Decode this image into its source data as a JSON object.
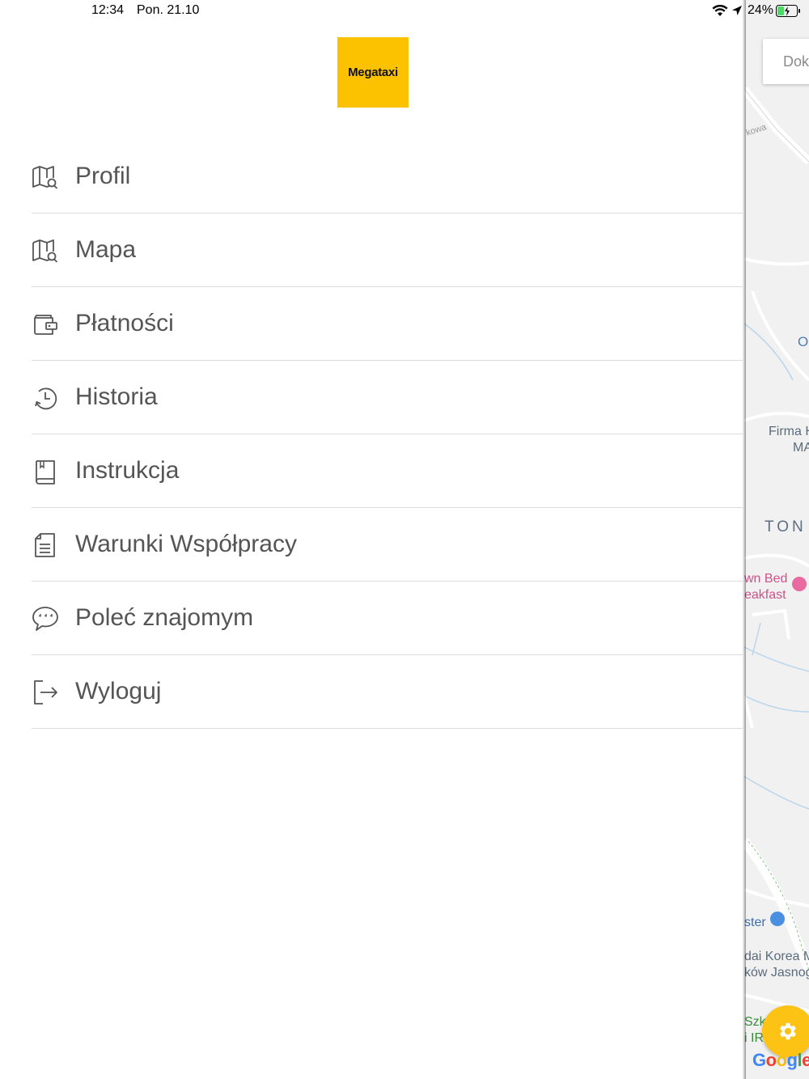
{
  "status_bar": {
    "time": "12:34",
    "date": "Pon. 21.10",
    "battery_percent": "24%"
  },
  "logo": {
    "text": "Megataxi",
    "bg_color": "#fcc200"
  },
  "menu": {
    "items": [
      {
        "label": "Profil",
        "icon": "map-search-icon"
      },
      {
        "label": "Mapa",
        "icon": "map-search-icon"
      },
      {
        "label": "Płatności",
        "icon": "wallet-icon"
      },
      {
        "label": "Historia",
        "icon": "history-icon"
      },
      {
        "label": "Instrukcja",
        "icon": "book-icon"
      },
      {
        "label": "Warunki Współpracy",
        "icon": "document-icon"
      },
      {
        "label": "Poleć znajomym",
        "icon": "chat-bubble-icon"
      },
      {
        "label": "Wyloguj",
        "icon": "logout-icon"
      }
    ]
  },
  "map": {
    "search_text": "Dok",
    "labels": {
      "street": "kowa",
      "poi_o": "O",
      "firma": "Firma H",
      "firma2": "MA",
      "ton": "TON",
      "bnb1": "wn Bed",
      "bnb2": "eakfast",
      "ster": "ster",
      "korea1": "dai Korea M",
      "korea2": "ków Jasnog",
      "szk": "Szk",
      "ir": "i IR"
    },
    "google_text": "Google",
    "accent_color": "#fdc314"
  }
}
